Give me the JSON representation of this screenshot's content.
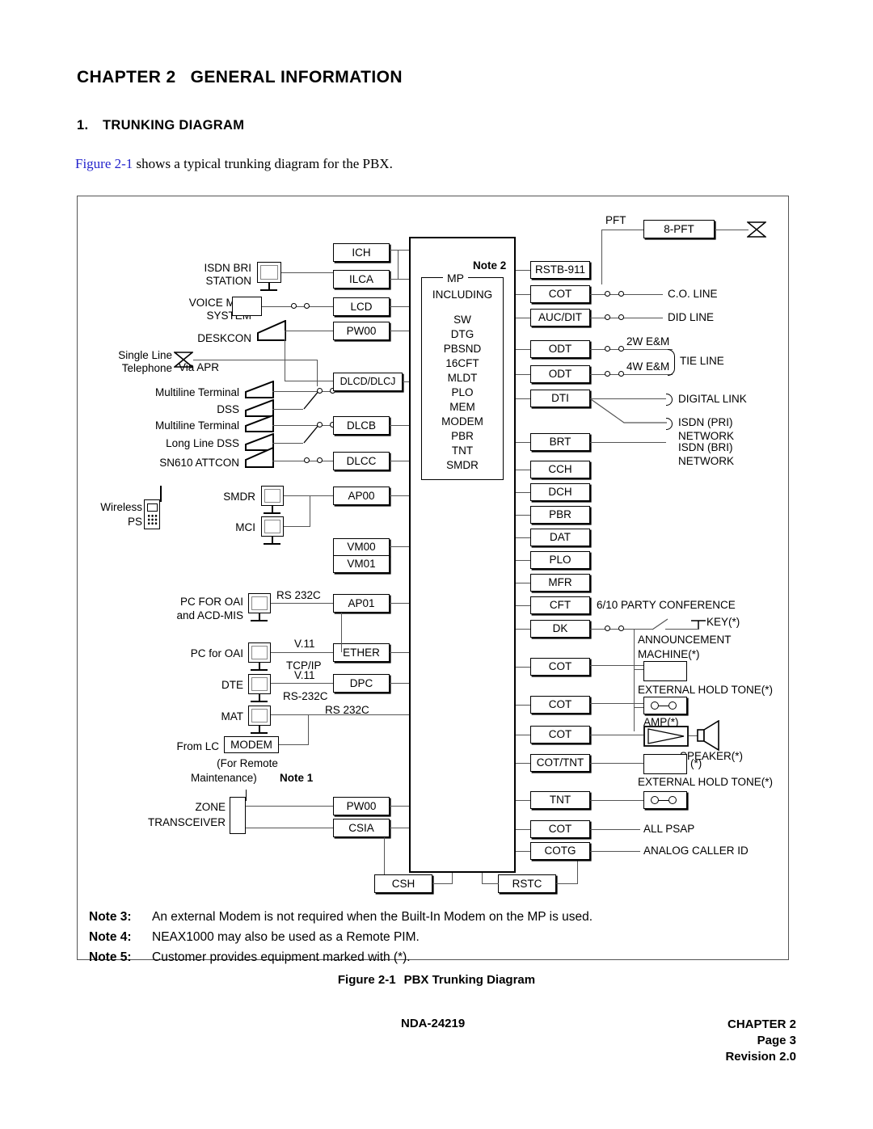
{
  "document": {
    "chapter_label": "CHAPTER 2",
    "chapter_title": "GENERAL INFORMATION",
    "section_number": "1.",
    "section_title": "TRUNKING DIAGRAM",
    "intro_figure_ref": "Figure 2-1",
    "intro_text": " shows a typical trunking diagram for the PBX.",
    "figure_caption_number": "Figure 2-1",
    "figure_caption_title": "PBX Trunking Diagram"
  },
  "footer": {
    "doc_id": "NDA-24219",
    "chapter": "CHAPTER 2",
    "page": "Page 3",
    "revision": "Revision 2.0"
  },
  "notes": [
    {
      "label": "Note 3:",
      "text": "An external Modem is not required when the Built-In Modem on the MP is used."
    },
    {
      "label": "Note 4:",
      "text": "NEAX1000 may also be used as a Remote PIM."
    },
    {
      "label": "Note 5:",
      "text": "Customer provides equipment marked with (*)."
    }
  ],
  "diagram": {
    "mp": {
      "legend": "MP",
      "note": "Note 2",
      "including_label": "INCLUDING",
      "contents": [
        "SW",
        "DTG",
        "PBSND",
        "16CFT",
        "MLDT",
        "PLO",
        "MEM",
        "MODEM",
        "PBR",
        "TNT",
        "SMDR"
      ]
    },
    "left_cards": [
      {
        "name": "ICH"
      },
      {
        "name": "ILCA"
      },
      {
        "name": "LCD"
      },
      {
        "name": "PW00"
      },
      {
        "name": "DLCD/DLCJ"
      },
      {
        "name": "DLCB"
      },
      {
        "name": "DLCC"
      },
      {
        "name": "AP00"
      },
      {
        "name": "VM00"
      },
      {
        "name": "VM01"
      },
      {
        "name": "AP01"
      },
      {
        "name": "ETHER"
      },
      {
        "name": "DPC"
      },
      {
        "name": "PW00"
      },
      {
        "name": "CSIA"
      }
    ],
    "left_devices": [
      {
        "label_line1": "ISDN BRI",
        "label_line2": "STATION"
      },
      {
        "label_line1": "VOICE MAIL",
        "label_line2": "SYSTEM"
      },
      {
        "label_line1": "DESKCON",
        "label_line2": ""
      },
      {
        "label_line1": "Single Line",
        "label_line2": "Telephone"
      },
      {
        "label_line1": "Via APR",
        "label_line2": ""
      },
      {
        "label_line1": "Multiline Terminal",
        "label_line2": ""
      },
      {
        "label_line1": "DSS",
        "label_line2": ""
      },
      {
        "label_line1": "Multiline Terminal",
        "label_line2": ""
      },
      {
        "label_line1": "Long Line DSS",
        "label_line2": ""
      },
      {
        "label_line1": "SN610 ATTCON",
        "label_line2": ""
      },
      {
        "label_line1": "Wireless",
        "label_line2": "PS"
      },
      {
        "label_line1": "SMDR",
        "label_line2": ""
      },
      {
        "label_line1": "MCI",
        "label_line2": ""
      },
      {
        "label_line1": "PC FOR OAI",
        "label_line2": "and ACD-MIS"
      },
      {
        "label_line1": "PC for OAI",
        "label_line2": ""
      },
      {
        "label_line1": "DTE",
        "label_line2": ""
      },
      {
        "label_line1": "MAT",
        "label_line2": ""
      },
      {
        "label_line1": "From LC",
        "label_line2": "MODEM"
      },
      {
        "label_line1": "ZONE",
        "label_line2": "TRANSCEIVER"
      }
    ],
    "left_link_labels": [
      "RS 232C",
      "V.11",
      "TCP/IP",
      "V.11",
      "RS-232C",
      "RS 232C"
    ],
    "modem_note": {
      "line1": "(For Remote",
      "line2": "Maintenance)",
      "note": "Note 1"
    },
    "right_cards": [
      "RSTB-911",
      "COT",
      "AUC/DIT",
      "ODT",
      "ODT",
      "DTI",
      "BRT",
      "CCH",
      "DCH",
      "PBR",
      "DAT",
      "PLO",
      "MFR",
      "CFT",
      "DK",
      "COT",
      "COT",
      "COT",
      "COT/TNT",
      "TNT",
      "COT",
      "COTG"
    ],
    "bottom_cards": [
      "CSH",
      "RSTC"
    ],
    "right_labels": [
      "PFT",
      "8-PFT",
      "C.O. LINE",
      "DID LINE",
      "2W E&M",
      "4W E&M",
      "TIE LINE",
      "DIGITAL LINK",
      "ISDN (PRI)",
      "NETWORK",
      "ISDN (BRI)",
      "NETWORK",
      "6/10 PARTY CONFERENCE",
      "KEY(*)",
      "ANNOUNCEMENT",
      "MACHINE(*)",
      "EXTERNAL HOLD TONE(*)",
      "AMP(*)",
      "SPEAKER(*)",
      "(*)",
      "EXTERNAL HOLD TONE(*)",
      "ALL PSAP",
      "ANALOG CALLER ID"
    ]
  }
}
